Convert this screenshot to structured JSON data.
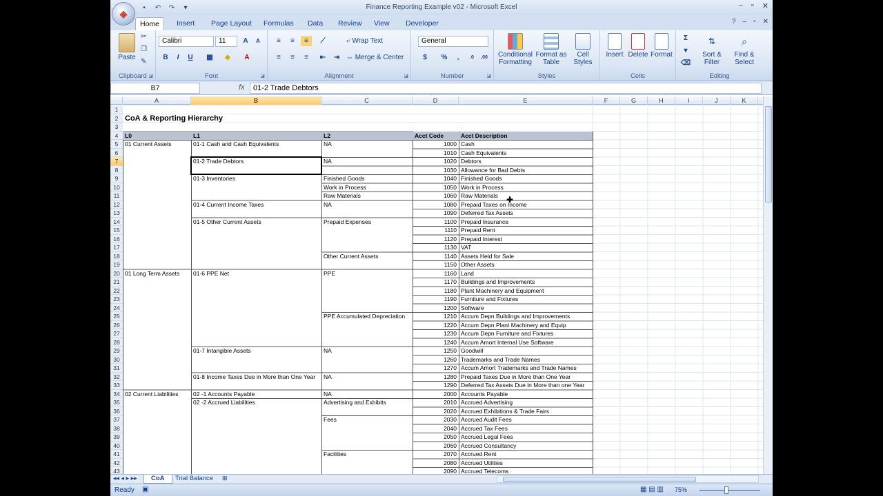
{
  "window": {
    "title": "Finance Reporting Example v02 - Microsoft Excel",
    "controls": [
      "–",
      "▫",
      "✕"
    ],
    "inner_controls": [
      "?",
      "–",
      "▫",
      "✕"
    ]
  },
  "ribbon": {
    "tabs": [
      "Home",
      "Insert",
      "Page Layout",
      "Formulas",
      "Data",
      "Review",
      "View",
      "Developer"
    ],
    "active_tab": "Home",
    "groups": {
      "clipboard": "Clipboard",
      "font": "Font",
      "alignment": "Alignment",
      "number": "Number",
      "styles": "Styles",
      "cells": "Cells",
      "editing": "Editing"
    },
    "paste": "Paste",
    "font_name": "Calibri",
    "font_size": "11",
    "wrap_text": "Wrap Text",
    "merge_center": "Merge & Center",
    "number_format": "General",
    "conditional": "Conditional Formatting",
    "format_table": "Format as Table",
    "cell_styles": "Cell Styles",
    "insert": "Insert",
    "delete": "Delete",
    "format": "Format",
    "sort": "Sort & Filter",
    "find": "Find & Select"
  },
  "formula_bar": {
    "name_box": "B7",
    "fx": "fx",
    "content": "01-2 Trade Debtors"
  },
  "columns": [
    "A",
    "B",
    "C",
    "D",
    "E",
    "F",
    "G",
    "H",
    "I",
    "J",
    "K"
  ],
  "rows": [
    "1",
    "2",
    "3",
    "4",
    "5",
    "6",
    "7",
    "8",
    "9",
    "10",
    "11",
    "12",
    "13",
    "14",
    "15",
    "16",
    "17",
    "18",
    "19",
    "20",
    "21",
    "22",
    "23",
    "24",
    "25",
    "26",
    "27",
    "28",
    "29",
    "30",
    "31",
    "32",
    "33",
    "34",
    "35",
    "36",
    "37",
    "38",
    "39",
    "40",
    "41",
    "42",
    "43"
  ],
  "sheet": {
    "title": "CoA & Reporting Hierarchy",
    "headers": {
      "l0": "L0",
      "l1": "L1",
      "l2": "L2",
      "code": "Acct Code",
      "desc": "Acct Description"
    },
    "l0": [
      {
        "row": 5,
        "text": "01 Current Assets"
      },
      {
        "row": 20,
        "text": "01 Long Term Assets"
      },
      {
        "row": 34,
        "text": "02 Current Liabilities"
      }
    ],
    "l1": [
      {
        "row": 5,
        "text": "01-1 Cash and Cash Equivalents"
      },
      {
        "row": 7,
        "text": "01-2 Trade Debtors"
      },
      {
        "row": 9,
        "text": "01-3 Inventories"
      },
      {
        "row": 12,
        "text": "01-4 Current Income Taxes"
      },
      {
        "row": 14,
        "text": "01-5 Other Current Assets"
      },
      {
        "row": 20,
        "text": "01-6 PPE Net"
      },
      {
        "row": 29,
        "text": "01-7 Intangible Assets"
      },
      {
        "row": 32,
        "text": "01-8 Income Taxes Due in More than One Year"
      },
      {
        "row": 34,
        "text": "02 -1 Accounts Payable"
      },
      {
        "row": 35,
        "text": "02 -2 Accrued Liabilities"
      }
    ],
    "l2": [
      {
        "row": 5,
        "text": "NA"
      },
      {
        "row": 7,
        "text": "NA"
      },
      {
        "row": 9,
        "text": "Finished Goods"
      },
      {
        "row": 10,
        "text": "Work in Process"
      },
      {
        "row": 11,
        "text": "Raw Materials"
      },
      {
        "row": 12,
        "text": "NA"
      },
      {
        "row": 14,
        "text": "Prepaid Expenses"
      },
      {
        "row": 18,
        "text": "Other Current Assets"
      },
      {
        "row": 20,
        "text": "PPE"
      },
      {
        "row": 25,
        "text": "PPE Accumulated Depreciation"
      },
      {
        "row": 29,
        "text": "NA"
      },
      {
        "row": 32,
        "text": "NA"
      },
      {
        "row": 34,
        "text": "NA"
      },
      {
        "row": 35,
        "text": "Advertising and Exhibits"
      },
      {
        "row": 37,
        "text": "Fees"
      },
      {
        "row": 41,
        "text": "Facilities"
      }
    ],
    "accounts": [
      {
        "row": 5,
        "code": "1000",
        "desc": "Cash"
      },
      {
        "row": 6,
        "code": "1010",
        "desc": "Cash Equivalents"
      },
      {
        "row": 7,
        "code": "1020",
        "desc": "Debtors"
      },
      {
        "row": 8,
        "code": "1030",
        "desc": "Allowance for Bad Debts"
      },
      {
        "row": 9,
        "code": "1040",
        "desc": "Finished Goods"
      },
      {
        "row": 10,
        "code": "1050",
        "desc": "Work in Process"
      },
      {
        "row": 11,
        "code": "1060",
        "desc": "Raw Materials"
      },
      {
        "row": 12,
        "code": "1080",
        "desc": "Prepaid Taxes on Income"
      },
      {
        "row": 13,
        "code": "1090",
        "desc": "Deferred Tax Assets"
      },
      {
        "row": 14,
        "code": "1100",
        "desc": "Prepaid Insurance"
      },
      {
        "row": 15,
        "code": "1110",
        "desc": "Prepaid Rent"
      },
      {
        "row": 16,
        "code": "1120",
        "desc": "Prepaid Interest"
      },
      {
        "row": 17,
        "code": "1130",
        "desc": "VAT"
      },
      {
        "row": 18,
        "code": "1140",
        "desc": "Assets Held for Sale"
      },
      {
        "row": 19,
        "code": "1150",
        "desc": "Other Assets"
      },
      {
        "row": 20,
        "code": "1160",
        "desc": "Land"
      },
      {
        "row": 21,
        "code": "1170",
        "desc": "Buildings and Improvements"
      },
      {
        "row": 22,
        "code": "1180",
        "desc": "Plant Machinery and Equipment"
      },
      {
        "row": 23,
        "code": "1190",
        "desc": "Furniture and Fixtures"
      },
      {
        "row": 24,
        "code": "1200",
        "desc": "Software"
      },
      {
        "row": 25,
        "code": "1210",
        "desc": "Accum Depn Buildings and Improvements"
      },
      {
        "row": 26,
        "code": "1220",
        "desc": "Accum Depn Plant Machinery and Equip"
      },
      {
        "row": 27,
        "code": "1230",
        "desc": "Accum Depn Furniture and Fixtures"
      },
      {
        "row": 28,
        "code": "1240",
        "desc": "Accum Amort Internal Use Software"
      },
      {
        "row": 29,
        "code": "1250",
        "desc": "Goodwill"
      },
      {
        "row": 30,
        "code": "1260",
        "desc": "Trademarks and Trade Names"
      },
      {
        "row": 31,
        "code": "1270",
        "desc": "Accum Amort Trademarks and Trade Names"
      },
      {
        "row": 32,
        "code": "1280",
        "desc": "Prepaid Taxes Due in More than One Year"
      },
      {
        "row": 33,
        "code": "1290",
        "desc": "Deferred Tax Assets Due in More than one Year"
      },
      {
        "row": 34,
        "code": "2000",
        "desc": "Accounts Payable"
      },
      {
        "row": 35,
        "code": "2010",
        "desc": "Accrued Advertising"
      },
      {
        "row": 36,
        "code": "2020",
        "desc": "Accrued Exhibitions & Trade Fairs"
      },
      {
        "row": 37,
        "code": "2030",
        "desc": "Accrued Audit Fees"
      },
      {
        "row": 38,
        "code": "2040",
        "desc": "Accrued Tax Fees"
      },
      {
        "row": 39,
        "code": "2050",
        "desc": "Accrued Legal Fees"
      },
      {
        "row": 40,
        "code": "2060",
        "desc": "Accrued Consultancy"
      },
      {
        "row": 41,
        "code": "2070",
        "desc": "Accrued Rent"
      },
      {
        "row": 42,
        "code": "2080",
        "desc": "Accrued Utilities"
      },
      {
        "row": 43,
        "code": "2090",
        "desc": "Accrued Telecoms"
      }
    ]
  },
  "sheet_tabs": [
    "CoA",
    "Trial Balance"
  ],
  "active_sheet": "CoA",
  "status": {
    "ready": "Ready",
    "zoom": "75%"
  }
}
